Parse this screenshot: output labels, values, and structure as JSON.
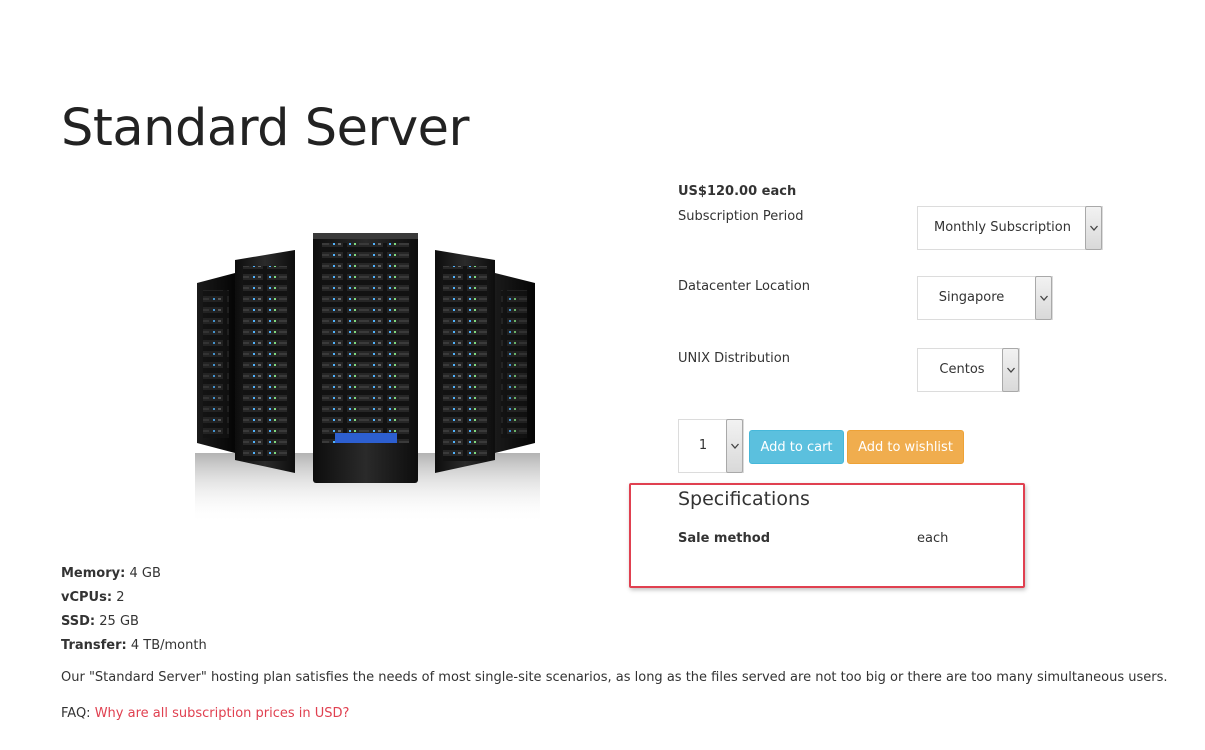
{
  "product": {
    "title": "Standard Server",
    "image_alt": "server-racks-image",
    "price": "US$120.00 each"
  },
  "options": [
    {
      "label": "Subscription Period",
      "selected": "Monthly Subscription"
    },
    {
      "label": "Datacenter Location",
      "selected": "Singapore"
    },
    {
      "label": "UNIX Distribution",
      "selected": "Centos"
    }
  ],
  "quantity": {
    "selected": "1"
  },
  "actions": {
    "add_to_cart": "Add to cart",
    "add_to_wishlist": "Add to wishlist"
  },
  "specifications": {
    "title": "Specifications",
    "rows": [
      {
        "key": "Sale method",
        "value": "each"
      }
    ]
  },
  "features": [
    {
      "key": "Memory:",
      "value": "4 GB"
    },
    {
      "key": "vCPUs:",
      "value": "2"
    },
    {
      "key": "SSD:",
      "value": "25 GB"
    },
    {
      "key": "Transfer:",
      "value": "4 TB/month"
    }
  ],
  "description": "Our \"Standard Server\" hosting plan satisfies the needs of most single-site scenarios, as long as the files served are not too big or there are too many simultaneous users.",
  "faq": {
    "prefix": "FAQ:",
    "link_text": "Why are all subscription prices in USD?"
  },
  "colors": {
    "cart_button": "#5bc0de",
    "wishlist_button": "#f0ad4e",
    "link": "#e04050",
    "highlight_border": "#e04050"
  }
}
